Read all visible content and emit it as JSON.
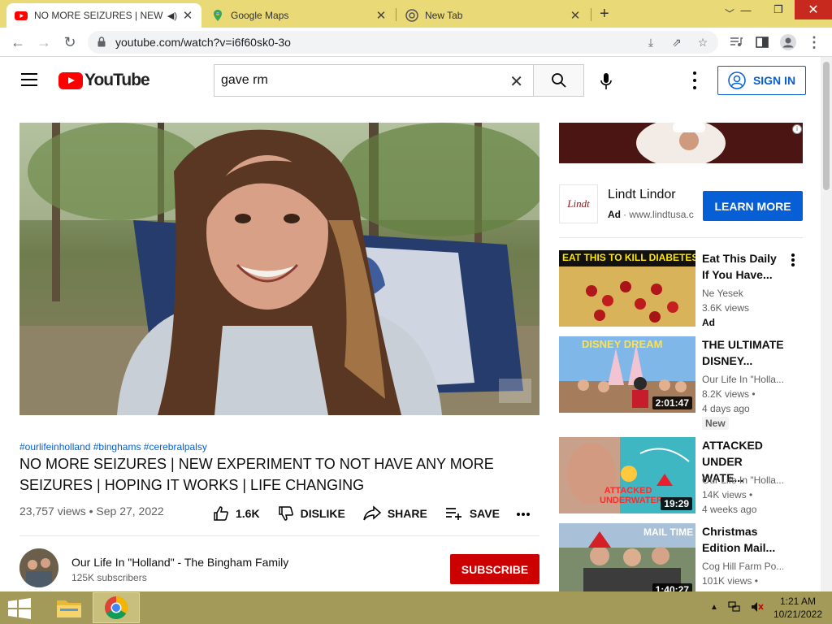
{
  "browser": {
    "tabs": [
      {
        "title": "NO MORE SEIZURES | NEW EX",
        "active": true
      },
      {
        "title": "Google Maps",
        "active": false
      },
      {
        "title": "New Tab",
        "active": false
      }
    ],
    "new_tab_symbol": "+",
    "close_symbol": "✕",
    "url": "youtube.com/watch?v=i6f60sk0-3o"
  },
  "yt_header": {
    "logo_text": "YouTube",
    "search_value": "gave rm",
    "sign_in_label": "SIGN IN"
  },
  "video": {
    "hashtags": "#ourlifeinholland #binghams #cerebralpalsy",
    "title": "NO MORE SEIZURES | NEW EXPERIMENT TO NOT HAVE ANY MORE SEIZURES | HOPING IT WORKS | LIFE CHANGING",
    "meta": "23,757 views • Sep 27, 2022",
    "like_count": "1.6K",
    "dislike_label": "DISLIKE",
    "share_label": "SHARE",
    "save_label": "SAVE"
  },
  "channel": {
    "name": "Our Life In \"Holland\" - The Bingham Family",
    "subscribers": "125K subscribers",
    "subscribe_label": "SUBSCRIBE"
  },
  "ad": {
    "logo_text": "Lindt",
    "name": "Lindt Lindor",
    "badge": "Ad",
    "domain": "· www.lindtusa.c",
    "cta": "LEARN MORE",
    "info_symbol": "i"
  },
  "related": [
    {
      "title": "Eat This Daily If You Have...",
      "channel": "Ne Yesek",
      "views": "3.6K views",
      "extra": "Ad",
      "thumb_text": "EAT THIS TO KILL DIABETES",
      "duration": ""
    },
    {
      "title": "THE ULTIMATE DISNEY...",
      "channel": "Our Life In \"Holla...",
      "views": "8.2K views •",
      "age": "4 days ago",
      "extra": "New",
      "thumb_text": "DISNEY DREAM",
      "duration": "2:01:47"
    },
    {
      "title": "ATTACKED UNDER WATE...",
      "channel": "Our Life In \"Holla...",
      "views": "14K views •",
      "age": "4 weeks ago",
      "thumb_text": "ATTACKED UNDERWATER",
      "duration": "19:29"
    },
    {
      "title": "Christmas Edition Mail...",
      "channel": "Cog Hill Farm Po...",
      "views": "101K views •",
      "thumb_text": "MAIL TIME",
      "duration": "1:40:27"
    }
  ],
  "taskbar": {
    "time": "1:21 AM",
    "date": "10/21/2022"
  },
  "colors": {
    "tab_strip": "#e9d977",
    "youtube_red": "#ff0000",
    "subscribe_red": "#cc0000",
    "link_blue": "#065fd4",
    "taskbar": "#a39a59"
  }
}
